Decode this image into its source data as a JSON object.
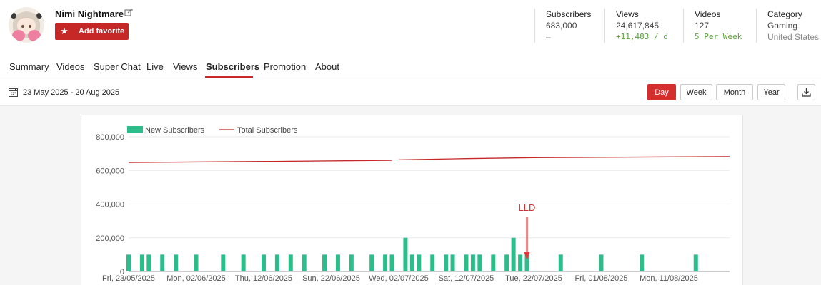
{
  "channel": {
    "name": "Nimi Nightmare",
    "favorite_label": "Add favorite"
  },
  "stats": {
    "subscribers": {
      "title": "Subscribers",
      "value": "683,000",
      "sub": "–"
    },
    "views": {
      "title": "Views",
      "value": "24,617,845",
      "sub": "+11,483 / d"
    },
    "videos": {
      "title": "Videos",
      "value": "127",
      "sub": "5 Per Week"
    },
    "category": {
      "title": "Category",
      "value": "Gaming",
      "sub": "United States"
    }
  },
  "tabs": [
    "Summary",
    "Videos",
    "Super Chat",
    "Live",
    "Views",
    "Subscribers",
    "Promotion",
    "About"
  ],
  "active_tab": "Subscribers",
  "date_range": "23 May 2025 - 20 Aug 2025",
  "periods": [
    "Day",
    "Week",
    "Month",
    "Year"
  ],
  "active_period": "Day",
  "colors": {
    "accent": "#d32f2f",
    "bar": "#2dbd8b",
    "line": "#c62828",
    "positive": "#5b9f3a"
  },
  "icons": [
    "external-link-icon",
    "star-icon",
    "calendar-icon",
    "download-icon"
  ],
  "chart_data": {
    "type": "bar",
    "legend": [
      "New Subscribers",
      "Total Subscribers"
    ],
    "legend_position": "top-left",
    "grid": true,
    "ylim": [
      0,
      800000
    ],
    "yticks": [
      0,
      200000,
      400000,
      600000,
      800000
    ],
    "ytick_labels": [
      "0",
      "200,000",
      "400,000",
      "600,000",
      "800,000"
    ],
    "xticks": [
      "2025-05-23",
      "2025-06-02",
      "2025-06-12",
      "2025-06-22",
      "2025-07-02",
      "2025-07-12",
      "2025-07-22",
      "2025-08-01",
      "2025-08-11"
    ],
    "xtick_labels": [
      "Fri, 23/05/2025",
      "Mon, 02/06/2025",
      "Thu, 12/06/2025",
      "Sun, 22/06/2025",
      "Wed, 02/07/2025",
      "Sat, 12/07/2025",
      "Tue, 22/07/2025",
      "Fri, 01/08/2025",
      "Mon, 11/08/2025"
    ],
    "series": [
      {
        "name": "New Subscribers",
        "type": "bar",
        "dates": [
          "2025-05-23",
          "2025-05-25",
          "2025-05-26",
          "2025-05-28",
          "2025-05-30",
          "2025-06-02",
          "2025-06-06",
          "2025-06-09",
          "2025-06-12",
          "2025-06-14",
          "2025-06-16",
          "2025-06-18",
          "2025-06-21",
          "2025-06-23",
          "2025-06-25",
          "2025-06-28",
          "2025-06-30",
          "2025-07-01",
          "2025-07-03",
          "2025-07-04",
          "2025-07-05",
          "2025-07-07",
          "2025-07-09",
          "2025-07-10",
          "2025-07-12",
          "2025-07-13",
          "2025-07-14",
          "2025-07-16",
          "2025-07-18",
          "2025-07-19",
          "2025-07-20",
          "2025-07-21",
          "2025-07-26",
          "2025-08-01",
          "2025-08-07",
          "2025-08-15"
        ],
        "values": [
          100000,
          100000,
          100000,
          100000,
          100000,
          100000,
          100000,
          100000,
          100000,
          100000,
          100000,
          100000,
          100000,
          100000,
          100000,
          100000,
          100000,
          100000,
          200000,
          100000,
          100000,
          100000,
          100000,
          100000,
          100000,
          100000,
          100000,
          100000,
          100000,
          200000,
          100000,
          100000,
          100000,
          100000,
          100000,
          100000
        ]
      },
      {
        "name": "Total Subscribers",
        "type": "line",
        "segments": [
          {
            "dates": [
              "2025-05-23",
              "2025-06-12",
              "2025-07-01"
            ],
            "values": [
              647000,
              653000,
              660000
            ]
          },
          {
            "dates": [
              "2025-07-02",
              "2025-07-12",
              "2025-07-22",
              "2025-08-01",
              "2025-08-11",
              "2025-08-20"
            ],
            "values": [
              663000,
              670000,
              676000,
              678000,
              680000,
              682000
            ]
          }
        ]
      }
    ],
    "annotations": [
      {
        "text": "LLD",
        "date": "2025-07-21"
      }
    ]
  }
}
